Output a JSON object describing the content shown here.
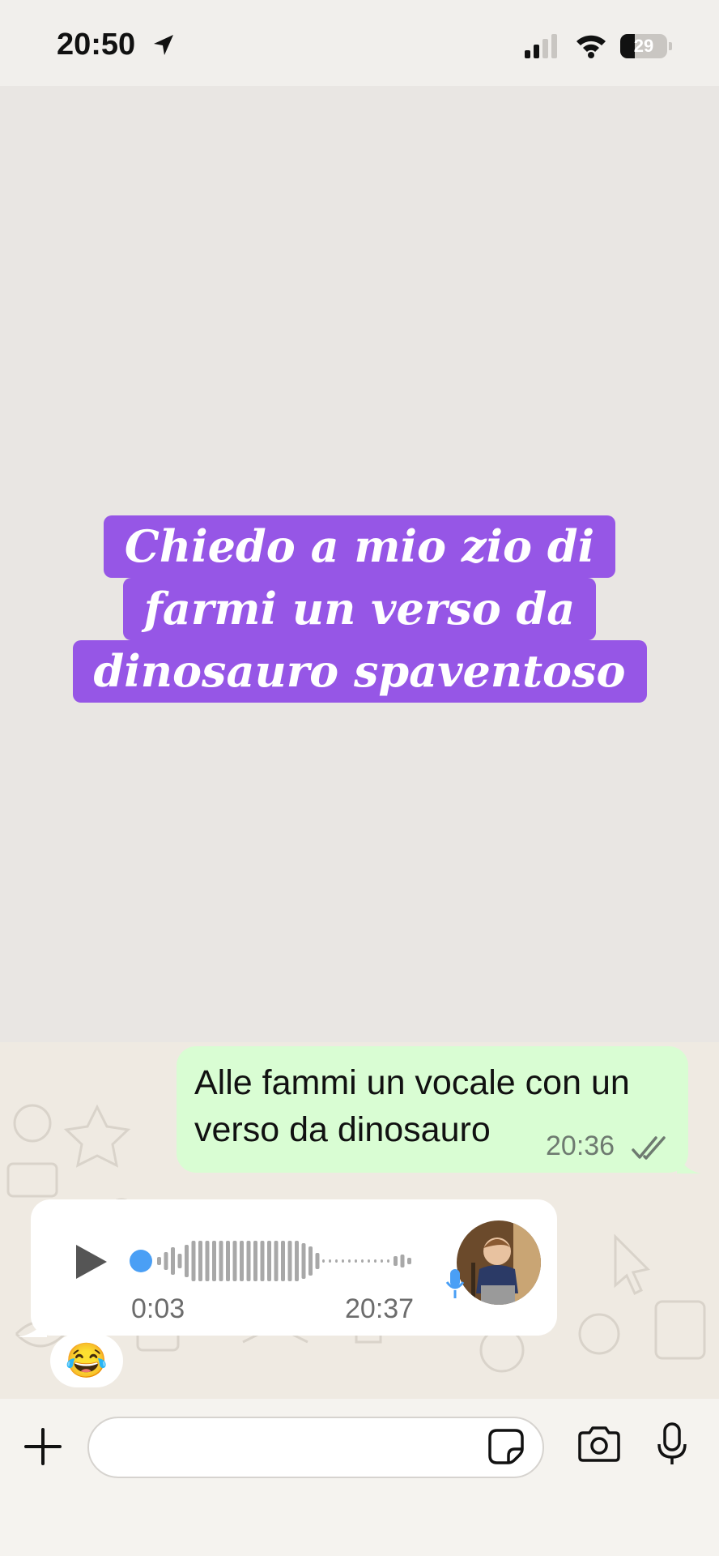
{
  "status_bar": {
    "time": "20:50",
    "battery": "29",
    "icons": [
      "location-arrow-icon",
      "signal-icon",
      "wifi-icon",
      "battery-icon"
    ]
  },
  "overlay_caption": {
    "line1": "Chiedo a mio zio di",
    "line2": "farmi un verso da",
    "line3": "dinosauro spaventoso",
    "background_color": "#9656e6"
  },
  "chat": {
    "outgoing": {
      "line1": "Alle fammi un vocale con un",
      "line2": "verso da dinosauro",
      "time": "20:36",
      "status_icon": "double-check-icon"
    },
    "incoming_voice": {
      "duration": "0:03",
      "time": "20:37",
      "progress": 0,
      "icons": [
        "play-icon",
        "microphone-icon",
        "avatar"
      ]
    },
    "reaction": "😂"
  },
  "composer": {
    "placeholder": "",
    "icons": [
      "plus-icon",
      "sticker-icon",
      "camera-icon",
      "microphone-icon"
    ]
  },
  "colors": {
    "outgoing_bubble": "#d9fdd3",
    "incoming_bubble": "#ffffff",
    "chat_background": "#efeae2",
    "accent_blue": "#4a9ff5"
  }
}
